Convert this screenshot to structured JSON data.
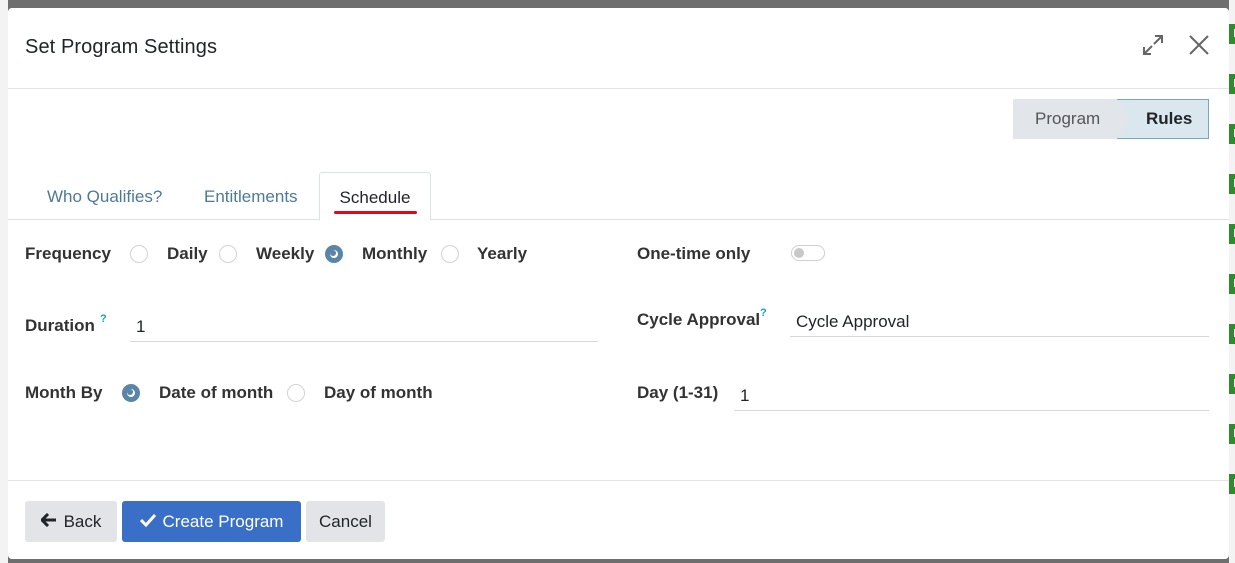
{
  "dialog": {
    "title": "Set Program Settings"
  },
  "statusbar": {
    "steps": [
      {
        "label": "Program",
        "active": false
      },
      {
        "label": "Rules",
        "active": true
      }
    ]
  },
  "tabs": [
    {
      "label": "Who Qualifies?",
      "active": false
    },
    {
      "label": "Entitlements",
      "active": false
    },
    {
      "label": "Schedule",
      "active": true
    }
  ],
  "form": {
    "frequency": {
      "label": "Frequency",
      "options": [
        "Daily",
        "Weekly",
        "Monthly",
        "Yearly"
      ],
      "selected": "Monthly"
    },
    "one_time": {
      "label": "One-time only",
      "value": false
    },
    "duration": {
      "label": "Duration",
      "help": "?",
      "value": "1"
    },
    "cycle_approval": {
      "label": "Cycle Approval",
      "help": "?",
      "value": "Cycle Approval"
    },
    "month_by": {
      "label": "Month By",
      "options": [
        "Date of month",
        "Day of month"
      ],
      "selected": "Date of month"
    },
    "day": {
      "label": "Day (1-31)",
      "value": "1"
    }
  },
  "footer": {
    "back_label": "Back",
    "create_label": "Create Program",
    "cancel_label": "Cancel"
  },
  "colors": {
    "primary": "#3a6fc8",
    "tab_active_underline": "#e0071d",
    "radio_checked": "#5a85a8",
    "tab_link": "#4d7a97"
  }
}
